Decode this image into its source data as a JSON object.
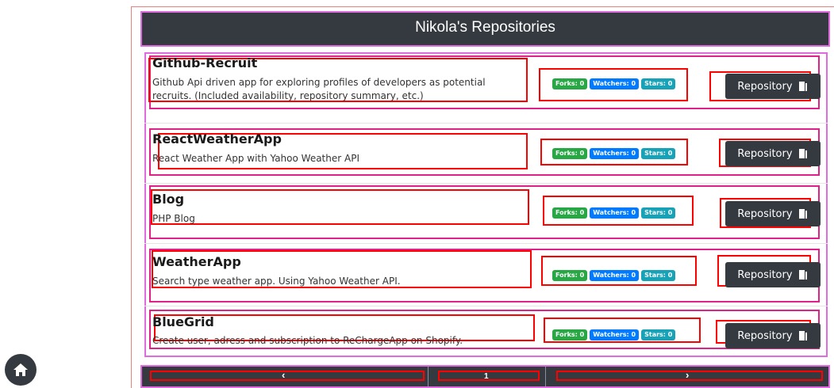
{
  "header": {
    "title": "Nikola's Repositories"
  },
  "repositories": [
    {
      "name": "Github-Recruit",
      "description": "Github Api driven app for exploring profiles of developers as potential recruits. (Included availability, repository summary, etc.)",
      "forks": "Forks: 0",
      "watchers": "Watchers: 0",
      "stars": "Stars: 0",
      "button_label": "Repository"
    },
    {
      "name": "ReactWeatherApp",
      "description": "React Weather App with Yahoo Weather API",
      "forks": "Forks: 0",
      "watchers": "Watchers: 0",
      "stars": "Stars: 0",
      "button_label": "Repository"
    },
    {
      "name": "Blog",
      "description": "PHP Blog",
      "forks": "Forks: 0",
      "watchers": "Watchers: 0",
      "stars": "Stars: 0",
      "button_label": "Repository"
    },
    {
      "name": "WeatherApp",
      "description": "Search type weather app. Using Yahoo Weather API.",
      "forks": "Forks: 0",
      "watchers": "Watchers: 0",
      "stars": "Stars: 0",
      "button_label": "Repository"
    },
    {
      "name": "BlueGrid",
      "description": "Create user, adress and subscription to ReChargeApp on Shopify.",
      "forks": "Forks: 0",
      "watchers": "Watchers: 0",
      "stars": "Stars: 0",
      "button_label": "Repository"
    }
  ],
  "pagination": {
    "prev": "‹",
    "page": "1",
    "next": "›"
  },
  "icons": {
    "home": "home-icon",
    "repository": "door-icon"
  },
  "colors": {
    "dark": "#343a40",
    "forks": "#28a745",
    "watchers": "#007bff",
    "stars": "#17a2b8"
  }
}
